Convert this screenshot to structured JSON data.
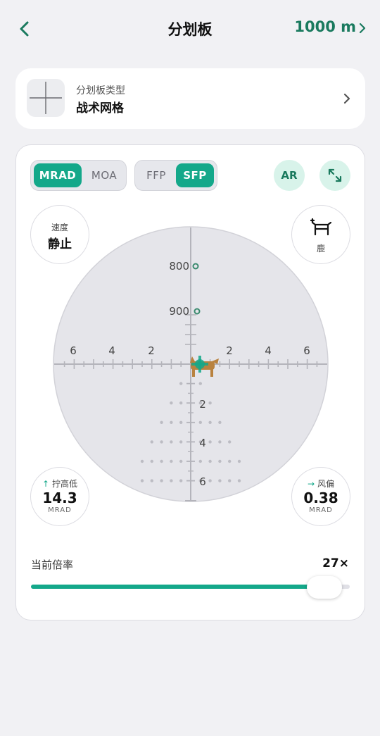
{
  "header": {
    "back_icon": "chevron-left-icon",
    "title": "分划板",
    "range_label": "1000 m",
    "range_icon": "chevron-right-icon"
  },
  "reticle_type": {
    "label": "分划板类型",
    "value": "战术网格",
    "thumb_icon": "crosshair-icon",
    "chevron_icon": "chevron-right-icon"
  },
  "units": {
    "options": [
      "MRAD",
      "MOA"
    ],
    "selected": "MRAD"
  },
  "focal_plane": {
    "options": [
      "FFP",
      "SFP"
    ],
    "selected": "SFP"
  },
  "ar_label": "AR",
  "expand_icon": "expand-icon",
  "speed": {
    "label": "速度",
    "value": "静止"
  },
  "target": {
    "label": "鹿",
    "icon": "deer-icon"
  },
  "elevation": {
    "label": "拧高低",
    "value": "14.3",
    "unit": "MRAD",
    "icon": "arrow-up-icon"
  },
  "windage": {
    "label": "风偏",
    "value": "0.38",
    "unit": "MRAD",
    "icon": "arrow-right-icon"
  },
  "reticle_view": {
    "range_marks": [
      "800",
      "900"
    ],
    "horizontal_labels": [
      "6",
      "4",
      "2",
      "2",
      "4",
      "6"
    ],
    "vertical_labels": [
      "2",
      "4",
      "6"
    ]
  },
  "zoom": {
    "label": "当前倍率",
    "value": "27×",
    "level_percent": 92
  },
  "colors": {
    "accent": "#14a88a",
    "accent_dark": "#1a7a5e",
    "accent_light": "#d8f3ea",
    "reticle_bg": "#e5e5ea",
    "reticle_line": "#b4b4bb",
    "target_brown": "#b9823f"
  }
}
